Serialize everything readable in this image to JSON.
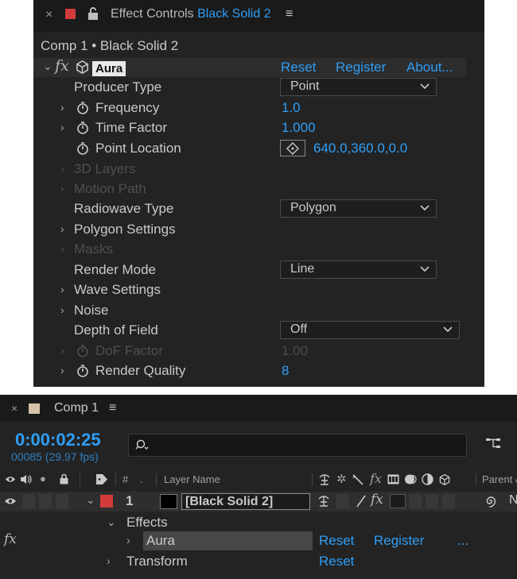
{
  "effect_controls": {
    "tab_title": "Effect Controls",
    "tab_layer": "Black Solid 2",
    "composition_path": "Comp 1 • Black Solid 2",
    "effect": {
      "name": "Aura",
      "reset": "Reset",
      "register": "Register",
      "about": "About..."
    },
    "params": {
      "producer_type": {
        "label": "Producer Type",
        "value": "Point"
      },
      "frequency": {
        "label": "Frequency",
        "value": "1.0"
      },
      "time_factor": {
        "label": "Time Factor",
        "value": "1.000"
      },
      "point_location": {
        "label": "Point Location",
        "value": "640.0,360.0,0.0"
      },
      "layers_3d": {
        "label": "3D Layers"
      },
      "motion_path": {
        "label": "Motion Path"
      },
      "radiowave_type": {
        "label": "Radiowave Type",
        "value": "Polygon"
      },
      "polygon_settings": {
        "label": "Polygon Settings"
      },
      "masks": {
        "label": "Masks"
      },
      "render_mode": {
        "label": "Render Mode",
        "value": "Line"
      },
      "wave_settings": {
        "label": "Wave Settings"
      },
      "noise": {
        "label": "Noise"
      },
      "depth_of_field": {
        "label": "Depth of Field",
        "value": "Off"
      },
      "dof_factor": {
        "label": "DoF Factor",
        "value": "1.00"
      },
      "render_quality": {
        "label": "Render Quality",
        "value": "8"
      }
    }
  },
  "timeline": {
    "tab_title": "Comp 1",
    "timecode": "0:00:02:25",
    "frames": "00085 (29.97 fps)",
    "search_placeholder": "",
    "headers": {
      "hash": "#",
      "layer_name": "Layer Name",
      "parent": "Parent &"
    },
    "layer": {
      "number": "1",
      "name": "[Black Solid 2]",
      "parent_value": "N"
    },
    "effects_label": "Effects",
    "fx_label": "fx",
    "effect_name": "Aura",
    "effect_reset": "Reset",
    "effect_register": "Register",
    "effect_more": "...",
    "transform_label": "Transform",
    "transform_reset": "Reset"
  },
  "colors": {
    "accent_blue": "#2f9ef6",
    "layer_label_red": "#d23b3b",
    "comp_swatch": "#d6c3a6",
    "panel_bg": "#232323"
  }
}
